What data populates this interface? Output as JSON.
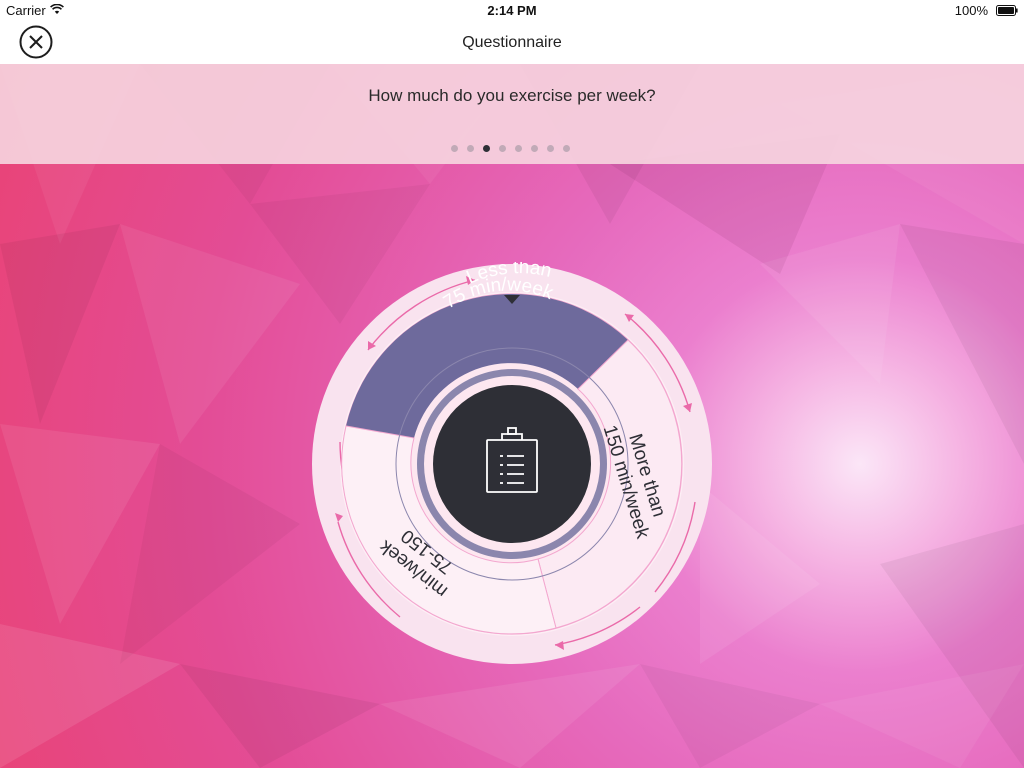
{
  "status_bar": {
    "carrier": "Carrier",
    "time": "2:14 PM",
    "battery": "100%"
  },
  "nav": {
    "title": "Questionnaire",
    "close_icon": "close-circle-icon"
  },
  "question": {
    "text": "How much do you exercise per week?",
    "page_count": 8,
    "current_page": 3
  },
  "wheel": {
    "center_icon": "clipboard-icon",
    "selected_index": 0,
    "options": [
      {
        "line1": "Less than",
        "line2": "75 min/week"
      },
      {
        "line1": "More than",
        "line2": "150 min/week"
      },
      {
        "line1": "75-150",
        "line2": "min/week"
      }
    ]
  },
  "colors": {
    "accent_selected": "#6e6a9c",
    "center_dark": "#2e2f36",
    "arrow_pink": "#ea6aa9"
  }
}
